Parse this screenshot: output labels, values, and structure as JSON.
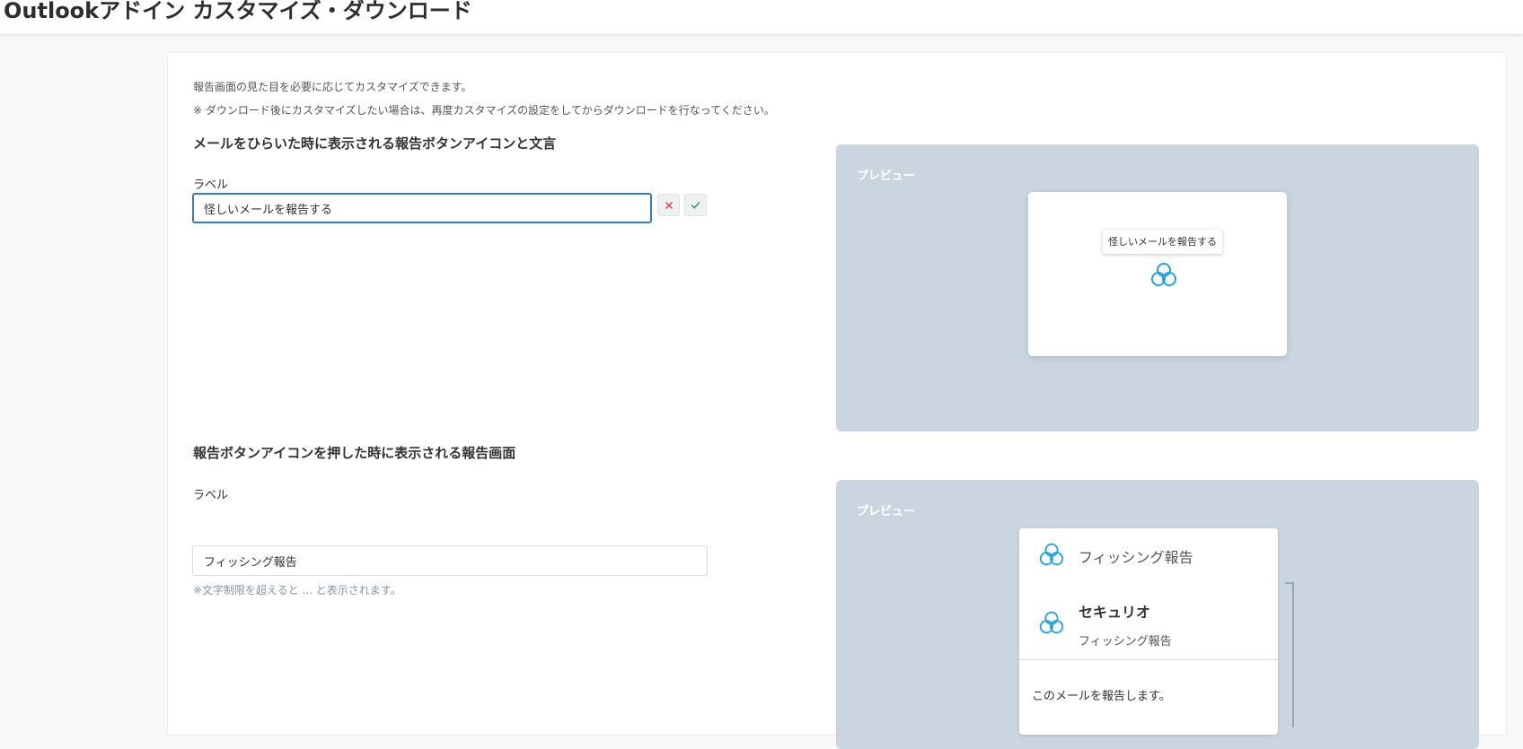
{
  "page": {
    "title": "Outlookアドイン カスタマイズ・ダウンロード"
  },
  "intro": {
    "line1": "報告画面の見た目を必要に応じてカスタマイズできます。",
    "line2": "※ ダウンロード後にカスタマイズしたい場合は、再度カスタマイズの設定をしてからダウンロードを行なってください。"
  },
  "section1": {
    "heading": "メールをひらいた時に表示される報告ボタンアイコンと文言",
    "field_label": "ラベル",
    "input_value": "怪しいメールを報告する",
    "cancel_icon": "close-icon",
    "confirm_icon": "check-icon",
    "preview": {
      "label": "プレビュー",
      "tooltip_text": "怪しいメールを報告する",
      "icon": "trefoil-logo-icon"
    }
  },
  "section2": {
    "heading": "報告ボタンアイコンを押した時に表示される報告画面",
    "field_label": "ラベル",
    "input_value": "フィッシング報告",
    "hint": "※文字制限を超えると ... と表示されます。",
    "preview": {
      "label": "プレビュー",
      "header_title": "フィッシング報告",
      "brand_name": "セキュリオ",
      "brand_subtitle": "フィッシング報告",
      "message": "このメールを報告します。",
      "icon": "trefoil-logo-icon"
    }
  },
  "colors": {
    "accent": "#2a9fd6",
    "preview_bg": "#cbd5e0",
    "focus_border": "#3b78b5",
    "danger": "#d9534f",
    "success": "#3a9a6a"
  }
}
